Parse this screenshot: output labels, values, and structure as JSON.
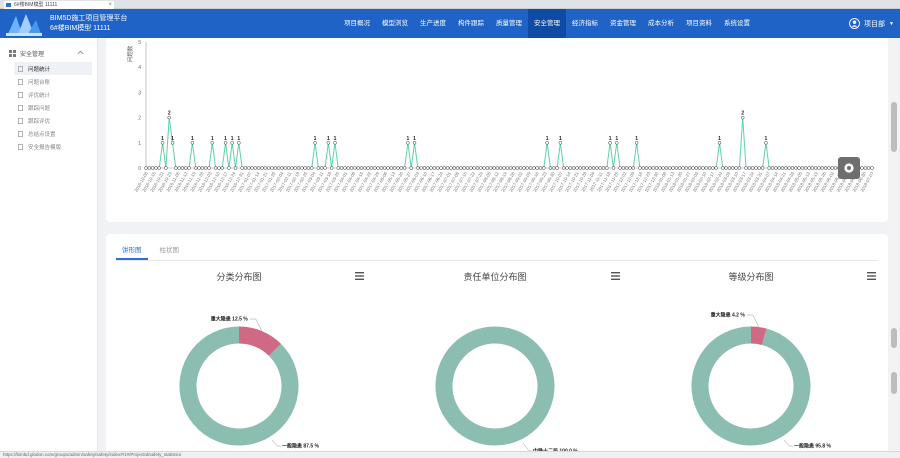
{
  "browser": {
    "tab_title": "6#楼BIM模型 11111",
    "close_glyph": "×",
    "status_url": "https://bim5d.glodon.com/groups/admin/safety/safety/index#/1#/ProjectId/safety_statistics"
  },
  "header": {
    "title": "BIM5D施工项目管理平台",
    "subtitle": "6#楼BIM模型 11111",
    "nav": [
      "项目概况",
      "模型浏览",
      "生产进度",
      "构件跟踪",
      "质量管理",
      "安全管理",
      "经济指标",
      "资金管理",
      "成本分析",
      "项目资料",
      "系统设置"
    ],
    "active_nav": "安全管理",
    "user_name": "项目部",
    "caret": "▼",
    "icons": {
      "logo": "building-logo-icon",
      "user": "user-icon",
      "caret": "caret-down-icon"
    }
  },
  "sidebar": {
    "group_label": "安全管理",
    "items": [
      "问题统计",
      "问题台账",
      "评优统计",
      "跟踪问题",
      "跟踪评优",
      "总结点设置",
      "安全报告模版"
    ],
    "active_index": 0,
    "icons": {
      "group": "grid-icon",
      "collapse": "chevron-up-icon",
      "item": "document-icon"
    }
  },
  "tabs": [
    "饼形图",
    "柱状图"
  ],
  "active_tab": "饼形图",
  "colors": {
    "accent": "#1f63c7",
    "line": "#5ed3a6",
    "donut_main": "#8bbdb0",
    "donut_highlight": "#d06a84"
  },
  "chart_data": [
    {
      "type": "line",
      "title": "",
      "ylabel": "问题数",
      "ylim": [
        0,
        5
      ],
      "yticks": [
        0,
        1,
        2,
        3,
        4,
        5
      ],
      "x": [
        "2016-10-08",
        "2016-10-15",
        "2016-10-22",
        "2016-10-29",
        "2016-11-05",
        "2016-11-12",
        "2016-11-19",
        "2016-11-26",
        "2016-12-03",
        "2016-12-10",
        "2016-12-17",
        "2016-12-24",
        "2016-12-31",
        "2017-01-07",
        "2017-01-14",
        "2017-01-21",
        "2017-01-28",
        "2017-02-04",
        "2017-02-11",
        "2017-02-18",
        "2017-02-25",
        "2017-03-04",
        "2017-03-11",
        "2017-03-18",
        "2017-03-25",
        "2017-04-01",
        "2017-04-08",
        "2017-04-15",
        "2017-04-22",
        "2017-04-29",
        "2017-05-06",
        "2017-05-13",
        "2017-05-20",
        "2017-05-27",
        "2017-06-03",
        "2017-06-10",
        "2017-06-17",
        "2017-06-24",
        "2017-07-01",
        "2017-07-08",
        "2017-07-15",
        "2017-07-22",
        "2017-07-29",
        "2017-08-05",
        "2017-08-12",
        "2017-08-19",
        "2017-08-26",
        "2017-09-02",
        "2017-09-09",
        "2017-09-16",
        "2017-09-23",
        "2017-09-30",
        "2017-10-07",
        "2017-10-14",
        "2017-10-21",
        "2017-10-28",
        "2017-11-04",
        "2017-11-11",
        "2017-11-18",
        "2017-11-25",
        "2017-12-02",
        "2017-12-09",
        "2017-12-16",
        "2017-12-23",
        "2017-12-30",
        "2018-01-06",
        "2018-01-13",
        "2018-01-20",
        "2018-01-27",
        "2018-02-03",
        "2018-02-10",
        "2018-02-17",
        "2018-02-24",
        "2018-03-03",
        "2018-03-10",
        "2018-03-17",
        "2018-03-24",
        "2018-03-31",
        "2018-04-07",
        "2018-04-14",
        "2018-04-21",
        "2018-04-28",
        "2018-05-05",
        "2018-05-12",
        "2018-05-19",
        "2018-05-26",
        "2018-06-02",
        "2018-06-09",
        "2018-06-16",
        "2018-06-23",
        "2018-06-30",
        "2018-07-07"
      ],
      "y": [
        0,
        0,
        0,
        0,
        0,
        1,
        0,
        2,
        1,
        0,
        0,
        0,
        0,
        0,
        1,
        0,
        0,
        0,
        0,
        0,
        1,
        0,
        0,
        0,
        1,
        0,
        1,
        0,
        1,
        0,
        0,
        0,
        0,
        0,
        0,
        0,
        0,
        0,
        0,
        0,
        0,
        0,
        0,
        0,
        0,
        0,
        0,
        0,
        0,
        0,
        0,
        1,
        0,
        0,
        0,
        1,
        0,
        1,
        0,
        0,
        0,
        0,
        0,
        0,
        0,
        0,
        0,
        0,
        0,
        0,
        0,
        0,
        0,
        0,
        0,
        0,
        0,
        0,
        0,
        1,
        0,
        1,
        0,
        0,
        0,
        0,
        0,
        0,
        0,
        0,
        0,
        0,
        0,
        0,
        0,
        0,
        0,
        0,
        0,
        0,
        0,
        0,
        0,
        0,
        0,
        0,
        0,
        0,
        0,
        0,
        0,
        0,
        0,
        0,
        0,
        0,
        0,
        0,
        0,
        0,
        0,
        1,
        0,
        0,
        0,
        1,
        0,
        0,
        0,
        0,
        0,
        0,
        0,
        0,
        0,
        0,
        0,
        0,
        0,
        0,
        1,
        0,
        1,
        0,
        0,
        0,
        0,
        0,
        1,
        0,
        0,
        0,
        0,
        0,
        0,
        0,
        0,
        0,
        0,
        0,
        0,
        0,
        0,
        0,
        0,
        0,
        0,
        0,
        0,
        0,
        0,
        0,
        0,
        1,
        0,
        0,
        0,
        0,
        0,
        0,
        2,
        0,
        0,
        0,
        0,
        0,
        0,
        1,
        0,
        0,
        0,
        0,
        0,
        0,
        0,
        0,
        0,
        0,
        0,
        0,
        0,
        0,
        0,
        0,
        0,
        0,
        0,
        0,
        0,
        0,
        0,
        0,
        0,
        0,
        0,
        0,
        0,
        0,
        0,
        0
      ]
    },
    {
      "type": "pie",
      "title": "分类分布图",
      "slices": [
        {
          "name": "重大隐患",
          "value": 12.5
        },
        {
          "name": "一般隐患",
          "value": 87.5
        }
      ],
      "labels": [
        "重大隐患 12.5 %",
        "一般隐患 87.5 %"
      ]
    },
    {
      "type": "pie",
      "title": "责任单位分布图",
      "slices": [
        {
          "name": "中铁十二局",
          "value": 100.0
        }
      ],
      "labels": [
        "中铁十二局 100.0 %"
      ]
    },
    {
      "type": "pie",
      "title": "等级分布图",
      "slices": [
        {
          "name": "重大隐患",
          "value": 4.2
        },
        {
          "name": "一般隐患",
          "value": 95.8
        }
      ],
      "labels": [
        "重大隐患 4.2 %",
        "一般隐患 95.8 %"
      ]
    }
  ]
}
